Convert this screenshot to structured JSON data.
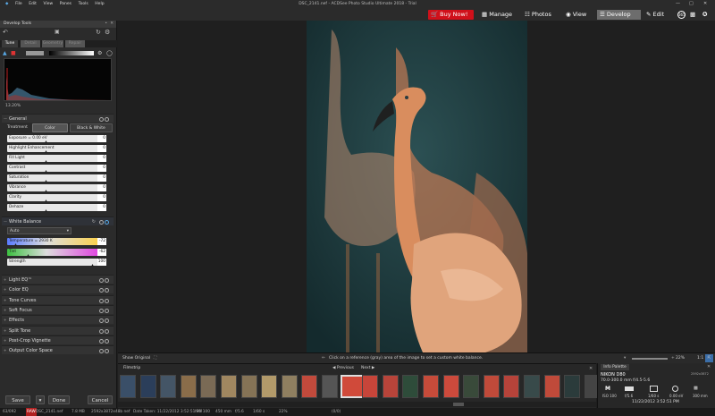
{
  "menu": {
    "items": [
      "File",
      "Edit",
      "View",
      "Panes",
      "Tools",
      "Help"
    ],
    "title": "DSC_2141.nef - ACDSee Photo Studio Ultimate 2018 - Trial"
  },
  "modes": {
    "buy": "Buy Now!",
    "manage": "Manage",
    "photos": "Photos",
    "view": "View",
    "develop": "Develop",
    "edit": "Edit",
    "badge365": "365"
  },
  "left": {
    "title": "Develop Tools",
    "tabs": [
      "Tune",
      "Detail",
      "Geometry",
      "Repair"
    ],
    "histo_value": "13.20%",
    "general": {
      "header": "General",
      "treatment_label": "Treatment",
      "color_btn": "Color",
      "bw_btn": "Black & White",
      "sliders": [
        {
          "label": "Exposure = 0.00 eV",
          "value": "0"
        },
        {
          "label": "Highlight Enhancement",
          "value": "0"
        },
        {
          "label": "Fill Light",
          "value": "0"
        },
        {
          "label": "Contrast",
          "value": "0"
        },
        {
          "label": "Saturation",
          "value": "0"
        },
        {
          "label": "Vibrance",
          "value": "0"
        },
        {
          "label": "Clarity",
          "value": "0"
        },
        {
          "label": "Dehaze",
          "value": "0"
        }
      ]
    },
    "wb": {
      "header": "White Balance",
      "preset": "Auto",
      "temp_label": "Temperature = 2930 K",
      "temp_value": "-72",
      "tint_label": "Tint",
      "tint_value": "-62",
      "strength_label": "Strength",
      "strength_value": "100"
    },
    "sections": [
      "Light EQ™",
      "Color EQ",
      "Tone Curves",
      "Soft Focus",
      "Effects",
      "Split Tone",
      "Post-Crop Vignette",
      "Output Color Space"
    ],
    "buttons": {
      "save": "Save",
      "done": "Done",
      "cancel": "Cancel"
    }
  },
  "status": {
    "show_original": "Show Original",
    "hint": "Click on a reference (gray) area of the image to set a custom white balance.",
    "zoom": "22%",
    "ratio": "1:1"
  },
  "filmstrip": {
    "title": "Filmstrip",
    "previous": "Previous",
    "next": "Next"
  },
  "info": {
    "title": "Info Palette",
    "camera": "NIKON D80",
    "dims": "2592x3872",
    "lens": "70.0-300.0 mm f/4.5-5.6",
    "date": "11/22/2012 3:52:51 PM",
    "exposure_mode": "M",
    "iso": "ISO 100",
    "fstop": "f/5.6",
    "shutter": "1/60 s",
    "ev": "0.00 eV",
    "focal": "300 mm",
    "fl2": "300 mm"
  },
  "bottombar": {
    "count": "63/092",
    "format": "RAW",
    "file": "DSC_2141.nef",
    "size": "7.8 MB",
    "dims": "2592x3872x48b nef",
    "date": "Date Taken: 11/22/2012 3:52:51 PM",
    "iso": "ISO 100",
    "focal": "450 mm",
    "f": "f/5.6",
    "shutter": "1/60 s",
    "zoom": "22%",
    "coords": "(0/0)"
  }
}
